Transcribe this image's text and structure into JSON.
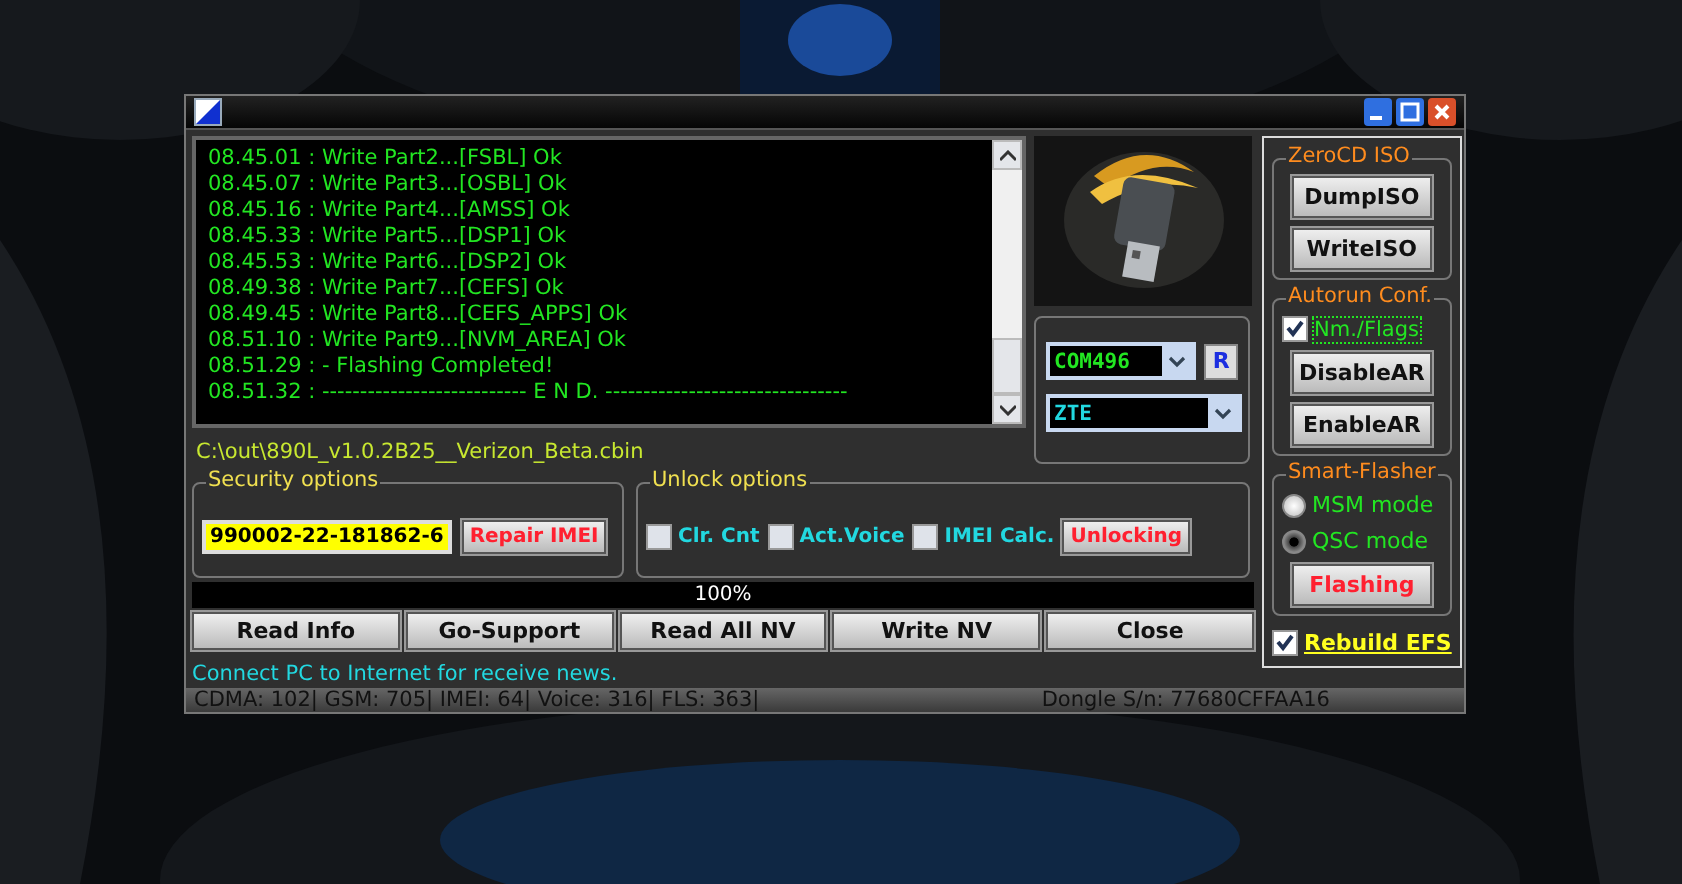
{
  "log": {
    "lines": [
      "08.45.01 : Write Part2...[FSBL] Ok",
      "08.45.07 : Write Part3...[OSBL] Ok",
      "08.45.16 : Write Part4...[AMSS] Ok",
      "08.45.33 : Write Part5...[DSP1] Ok",
      "08.45.53 : Write Part6...[DSP2] Ok",
      "08.49.38 : Write Part7...[CEFS] Ok",
      "08.49.45 : Write Part8...[CEFS_APPS] Ok",
      "08.51.10 : Write Part9...[NVM_AREA] Ok",
      "08.51.29 :  - Flashing Completed!",
      "08.51.32 : --------------------------- E N D. --------------------------------"
    ]
  },
  "file_path": "C:\\out\\890L_v1.0.2B25__Verizon_Beta.cbin",
  "port": {
    "value": "COM496",
    "refresh_button": "R"
  },
  "vendor": {
    "value": "ZTE"
  },
  "security": {
    "title": "Security options",
    "imei": "990002-22-181862-6",
    "button": "Repair IMEI"
  },
  "unlock": {
    "title": "Unlock options",
    "options": [
      {
        "label": "Clr. Cnt",
        "checked": false
      },
      {
        "label": "Act.Voice",
        "checked": false
      },
      {
        "label": "IMEI Calc.",
        "checked": false
      }
    ],
    "button": "Unlocking"
  },
  "progress": {
    "level": 1,
    "label": "100%"
  },
  "buttons": [
    "Read Info",
    "Go-Support",
    "Read All NV",
    "Write NV",
    "Close"
  ],
  "news": "Connect PC to Internet for receive news.",
  "zerocd": {
    "title": "ZeroCD ISO",
    "buttons": [
      "DumpISO",
      "WriteISO"
    ]
  },
  "autorun": {
    "title": "Autorun Conf.",
    "flags": {
      "label": "Nm./Flags",
      "checked": true
    },
    "buttons": [
      "DisableAR",
      "EnableAR"
    ]
  },
  "smart_flasher": {
    "title": "Smart-Flasher",
    "modes": [
      {
        "label": "MSM mode",
        "selected": false
      },
      {
        "label": "QSC mode",
        "selected": true
      }
    ],
    "button": "Flashing"
  },
  "rebuild_efs": {
    "label": "Rebuild EFS",
    "checked": true
  },
  "status_bar": {
    "counters": "CDMA: 102| GSM: 705| IMEI: 64| Voice: 316| FLS: 363|",
    "dongle": "Dongle S/n: 77680CFFAA16"
  }
}
